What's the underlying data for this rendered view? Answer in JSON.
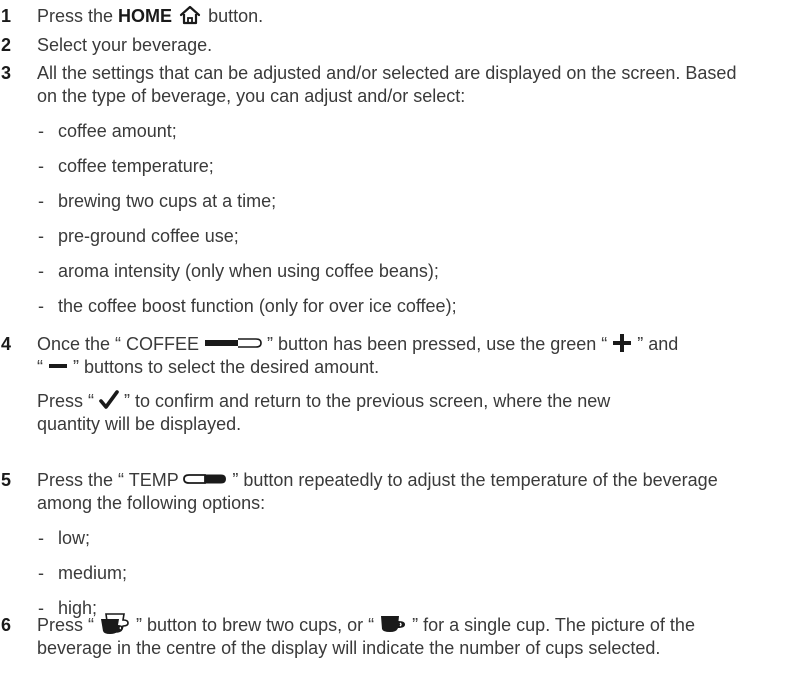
{
  "steps": [
    {
      "num": "1",
      "pre": "Press the ",
      "home_label": "HOME",
      "post": " button."
    },
    {
      "num": "2",
      "text": "Select your beverage."
    },
    {
      "num": "3",
      "text": "All the settings that can be adjusted and/or selected are displayed on the screen. Based on the type of beverage, you can adjust and/or select:",
      "items": [
        "coffee amount;",
        "coffee temperature;",
        "brewing two cups at a time;",
        "pre-ground coffee use;",
        "aroma intensity (only when using coffee beans);",
        "the coffee boost function (only for over ice coffee);"
      ]
    },
    {
      "num": "4",
      "line1_pre": "Once the “ COFFEE ",
      "line1_mid": " ” button has been pressed, use the green “ ",
      "line1_post": " ” and",
      "line2_pre": "“ ",
      "line2_post": " ” buttons to select the desired amount.",
      "confirm_pre": "Press “ ",
      "confirm_post": " ” to confirm and return to the previous screen, where the new quantity will be displayed."
    },
    {
      "num": "5",
      "pre": "Press the “ TEMP ",
      "post": " ” button repeatedly to adjust the temperature of the beverage among the following options:",
      "items": [
        "low;",
        "medium;",
        "high;"
      ]
    },
    {
      "num": "6",
      "pre": "Press “ ",
      "mid": " ” button to brew two cups, or “ ",
      "post": " ” for a single cup. The picture of the beverage in the centre of the display will indicate the number of cups selected."
    }
  ],
  "colors": {
    "text": "#3a3a3a",
    "number": "#1a1a1a",
    "icon": "#1a1a1a"
  },
  "icons": [
    "home-icon",
    "coffee-amount-icon",
    "plus-icon",
    "minus-icon",
    "checkmark-icon",
    "temperature-icon",
    "double-cup-icon",
    "single-cup-icon"
  ]
}
